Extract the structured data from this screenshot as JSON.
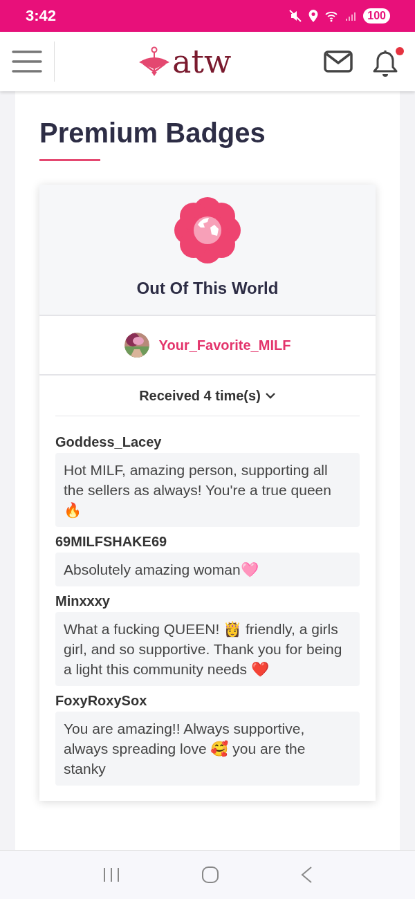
{
  "status_bar": {
    "time": "3:42",
    "battery": "100"
  },
  "header": {
    "logo_text": "atw",
    "has_unread": true
  },
  "page": {
    "title": "Premium Badges"
  },
  "badge": {
    "name": "Out Of This World"
  },
  "recipient": {
    "username": "Your_Favorite_MILF"
  },
  "received": {
    "label": "Received 4 time(s)"
  },
  "comments": [
    {
      "author": "Goddess_Lacey",
      "text": "Hot MILF, amazing person, supporting all the sellers as always! You're a true queen 🔥"
    },
    {
      "author": "69MILFSHAKE69",
      "text": "Absolutely amazing woman🩷"
    },
    {
      "author": "Minxxxy",
      "text": "What a fucking QUEEN! 👸 friendly, a girls girl, and so supportive. Thank you for being a light this community needs ❤️"
    },
    {
      "author": "FoxyRoxySox",
      "text": "You are amazing!! Always supportive, always spreading love 🥰 you are the stanky"
    }
  ]
}
